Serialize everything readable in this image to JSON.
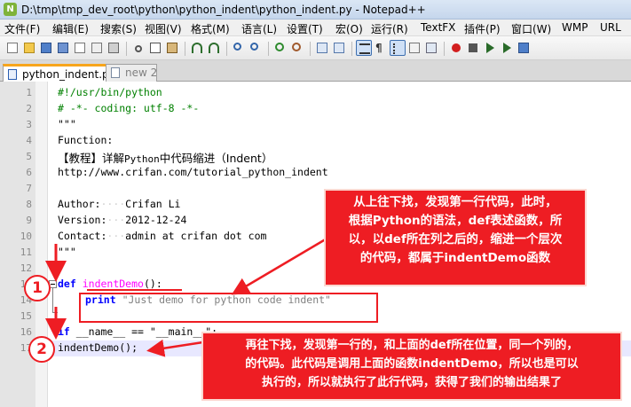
{
  "window": {
    "title": "D:\\tmp\\tmp_dev_root\\python\\python_indent\\python_indent.py - Notepad++"
  },
  "menu": [
    "文件(F)",
    "编辑(E)",
    "搜索(S)",
    "视图(V)",
    "格式(M)",
    "语言(L)",
    "设置(T)",
    "宏(O)",
    "运行(R)",
    "TextFX",
    "插件(P)",
    "窗口(W)",
    "WMP",
    "URL"
  ],
  "toolbar": {
    "buttons": [
      "new",
      "open",
      "save",
      "save-all",
      "close",
      "close-all",
      "print",
      "cut",
      "copy",
      "paste",
      "undo",
      "redo",
      "find",
      "replace",
      "zoom-in",
      "zoom-out",
      "sync-vertical",
      "sync-horizontal",
      "word-wrap",
      "show-all-chars",
      "indent-guide",
      "user-defined-lang",
      "doc-map",
      "record-macro",
      "stop-recording",
      "play-macro",
      "run-macro-multiple",
      "save-macro"
    ]
  },
  "tabs": [
    {
      "label": "python_indent.py",
      "active": true
    },
    {
      "label": "new  2",
      "active": false
    }
  ],
  "editor": {
    "line_numbers": [
      "1",
      "2",
      "3",
      "4",
      "5",
      "6",
      "7",
      "8",
      "9",
      "10",
      "11",
      "12",
      "13",
      "14",
      "15",
      "16",
      "17"
    ],
    "lines": {
      "l1": "#!/usr/bin/python",
      "l2": "# -*- coding: utf-8 -*-",
      "l3": "\"\"\"",
      "l4": "Function:",
      "l5a": "【教程】详解",
      "l5b": "Python",
      "l5c": "中代码缩进（Indent）",
      "l6": "http://www.crifan.com/tutorial_python_indent",
      "l7": "",
      "l8a": "Author:",
      "l8b": "Crifan Li",
      "l9a": "Version:",
      "l9b": "2012-12-24",
      "l10a": "Contact:",
      "l10b": "admin at crifan dot com",
      "l11": "\"\"\"",
      "l12": "",
      "l13a": "def",
      "l13b": "indentDemo",
      "l13c": "():",
      "l14a": "print",
      "l14b": "\"Just demo for python code indent\"",
      "l15": "",
      "l16a": "if",
      "l16b": "__name__ == \"__main__\":",
      "l17": "indentDemo();"
    }
  },
  "annotations": {
    "callout1": [
      "从上往下找，发现第一行代码，此时，",
      "根据Python的语法，def表述函数，所",
      "以，以def所在列之后的，缩进一个层次",
      "的代码，都属于indentDemo函数"
    ],
    "callout2": [
      "再往下找，发现第一行的，和上面的def所在位置，同一个列的，",
      "的代码。此代码是调用上面的函数indentDemo，所以也是可以",
      "执行的，所以就执行了此行代码，获得了我们的输出结果了"
    ],
    "markers": [
      "1",
      "2"
    ]
  },
  "colors": {
    "annotation_red": "#ee1d23",
    "keyword_blue": "#0000ff",
    "function_magenta": "#ff00ff",
    "comment_green": "#008000",
    "tab_accent": "#f7a51c"
  }
}
